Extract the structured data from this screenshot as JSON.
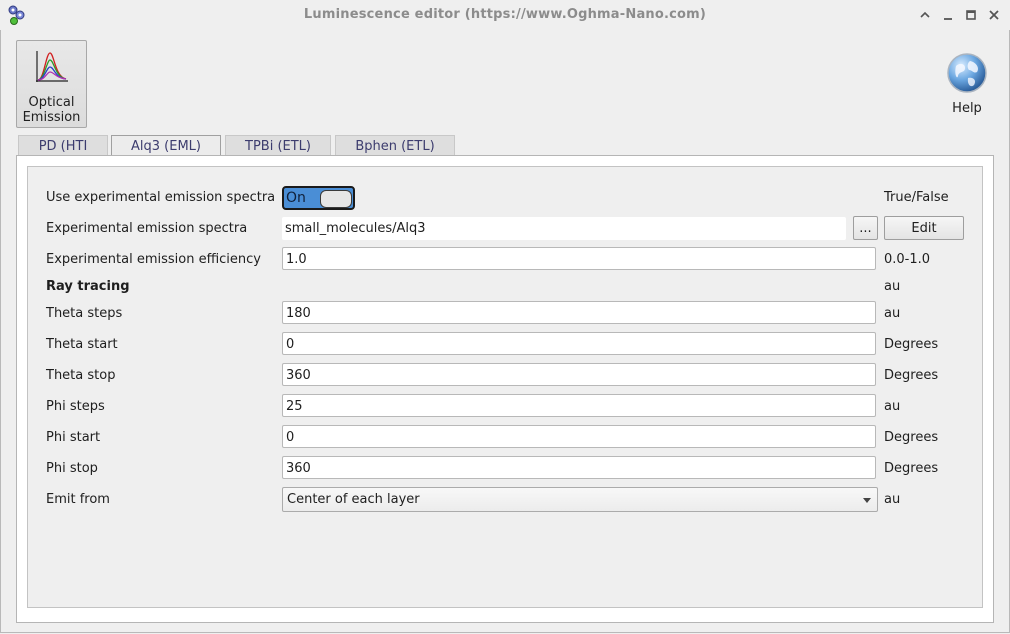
{
  "window": {
    "title": "Luminescence editor (https://www.Oghma-Nano.com)",
    "app_icon": "gear-cluster-icon",
    "controls": [
      "minimize-up-icon",
      "minimize-icon",
      "maximize-icon",
      "close-icon"
    ]
  },
  "toolbar": {
    "optical_emission_label_line1": "Optical",
    "optical_emission_label_line2": "Emission",
    "help_label": "Help"
  },
  "tabs": [
    {
      "label": "PD (HTI",
      "active": false
    },
    {
      "label": "Alq3 (EML)",
      "active": true
    },
    {
      "label": "TPBi (ETL)",
      "active": false
    },
    {
      "label": "Bphen (ETL)",
      "active": false
    }
  ],
  "form": {
    "use_exp_spectra": {
      "label": "Use experimental emission spectra",
      "toggle_text": "On",
      "unit": "True/False"
    },
    "exp_spectra": {
      "label": "Experimental emission spectra",
      "value": "small_molecules/Alq3",
      "browse_label": "...",
      "edit_label": "Edit"
    },
    "exp_efficiency": {
      "label": "Experimental emission efficiency",
      "value": "1.0",
      "unit": "0.0-1.0"
    },
    "ray_tracing": {
      "label": "Ray tracing",
      "unit": "au"
    },
    "theta_steps": {
      "label": "Theta steps",
      "value": "180",
      "unit": "au"
    },
    "theta_start": {
      "label": "Theta start",
      "value": "0",
      "unit": "Degrees"
    },
    "theta_stop": {
      "label": "Theta stop",
      "value": "360",
      "unit": "Degrees"
    },
    "phi_steps": {
      "label": "Phi steps",
      "value": "25",
      "unit": "au"
    },
    "phi_start": {
      "label": "Phi start",
      "value": "0",
      "unit": "Degrees"
    },
    "phi_stop": {
      "label": "Phi stop",
      "value": "360",
      "unit": "Degrees"
    },
    "emit_from": {
      "label": "Emit from",
      "value": "Center of each layer",
      "unit": "au"
    }
  },
  "colors": {
    "toggle_on": "#4a8ed6",
    "tab_active_underline": "#4d6bb3",
    "tab_text": "#3c3c6e"
  }
}
